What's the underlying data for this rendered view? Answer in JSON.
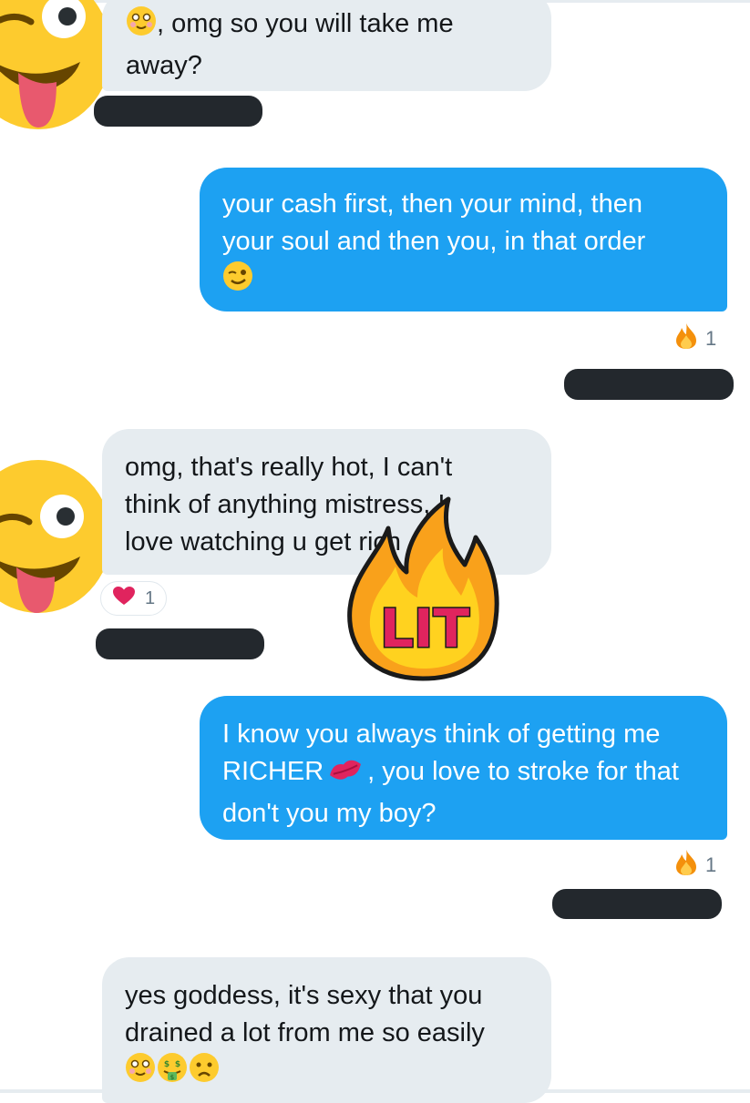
{
  "messages": [
    {
      "id": "m1",
      "direction": "received",
      "lines": [
        ", omg so you will take me",
        "away?"
      ]
    },
    {
      "id": "m2",
      "direction": "sent",
      "lines": [
        "your cash first, then your mind, then",
        "your soul and then you, in that order"
      ],
      "reaction": {
        "icon": "fire-icon",
        "count": "1"
      }
    },
    {
      "id": "m3",
      "direction": "received",
      "lines": [
        "omg, that's really hot, I can't",
        "think of anything mistress, I",
        "love watching u get rich"
      ],
      "reaction": {
        "icon": "heart-icon",
        "count": "1"
      }
    },
    {
      "id": "m4",
      "direction": "sent",
      "lines": [
        "I know you always think of getting me",
        "RICHER",
        ", you love to stroke for that",
        "don't you my boy?"
      ],
      "reaction": {
        "icon": "fire-icon",
        "count": "1"
      }
    },
    {
      "id": "m5",
      "direction": "received",
      "lines": [
        "yes goddess, it's sexy that you",
        "drained a lot from me so easily"
      ]
    }
  ],
  "sticker": {
    "text": "LIT",
    "icon": "lit-fire-sticker"
  },
  "icons": {
    "avatar": "winking-tongue-emoji",
    "reaction_sent": "fire-icon",
    "reaction_received": "heart-icon"
  },
  "colors": {
    "sent_bubble": "#1da1f2",
    "received_bubble": "#e6ecf0",
    "redaction": "#23282d",
    "heart": "#e0245e",
    "fire": "#f4900c"
  }
}
